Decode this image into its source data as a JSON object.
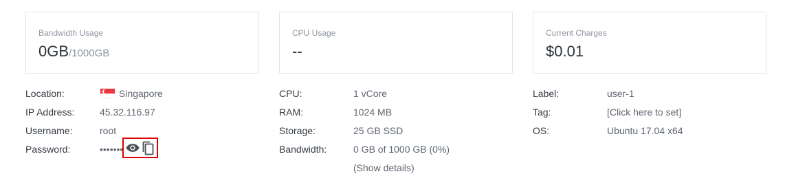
{
  "cards": {
    "bandwidth": {
      "label": "Bandwidth Usage",
      "value": "0GB",
      "unit": "/1000GB"
    },
    "cpu": {
      "label": "CPU Usage",
      "value": "--"
    },
    "charges": {
      "label": "Current Charges",
      "value": "$0.01"
    }
  },
  "server": {
    "location_label": "Location:",
    "location_value": "Singapore",
    "location_flag": "singapore-flag",
    "ip_label": "IP Address:",
    "ip_value": "45.32.116.97",
    "username_label": "Username:",
    "username_value": "root",
    "password_label": "Password:",
    "password_masked": "•••••••"
  },
  "specs": {
    "cpu_label": "CPU:",
    "cpu_value": "1 vCore",
    "ram_label": "RAM:",
    "ram_value": "1024 MB",
    "storage_label": "Storage:",
    "storage_value": "25 GB SSD",
    "bandwidth_label": "Bandwidth:",
    "bandwidth_value": "0 GB of 1000 GB (0%)",
    "show_details": "(Show details)"
  },
  "meta": {
    "label_label": "Label:",
    "label_value": "user-1",
    "tag_label": "Tag:",
    "tag_value": "[Click here to set]",
    "os_label": "OS:",
    "os_value": "Ubuntu 17.04 x64"
  },
  "icons": {
    "show_password": "eye-icon",
    "copy_password": "copy-icon"
  },
  "colors": {
    "link": "#2f7fd1",
    "highlight": "#e00000"
  }
}
